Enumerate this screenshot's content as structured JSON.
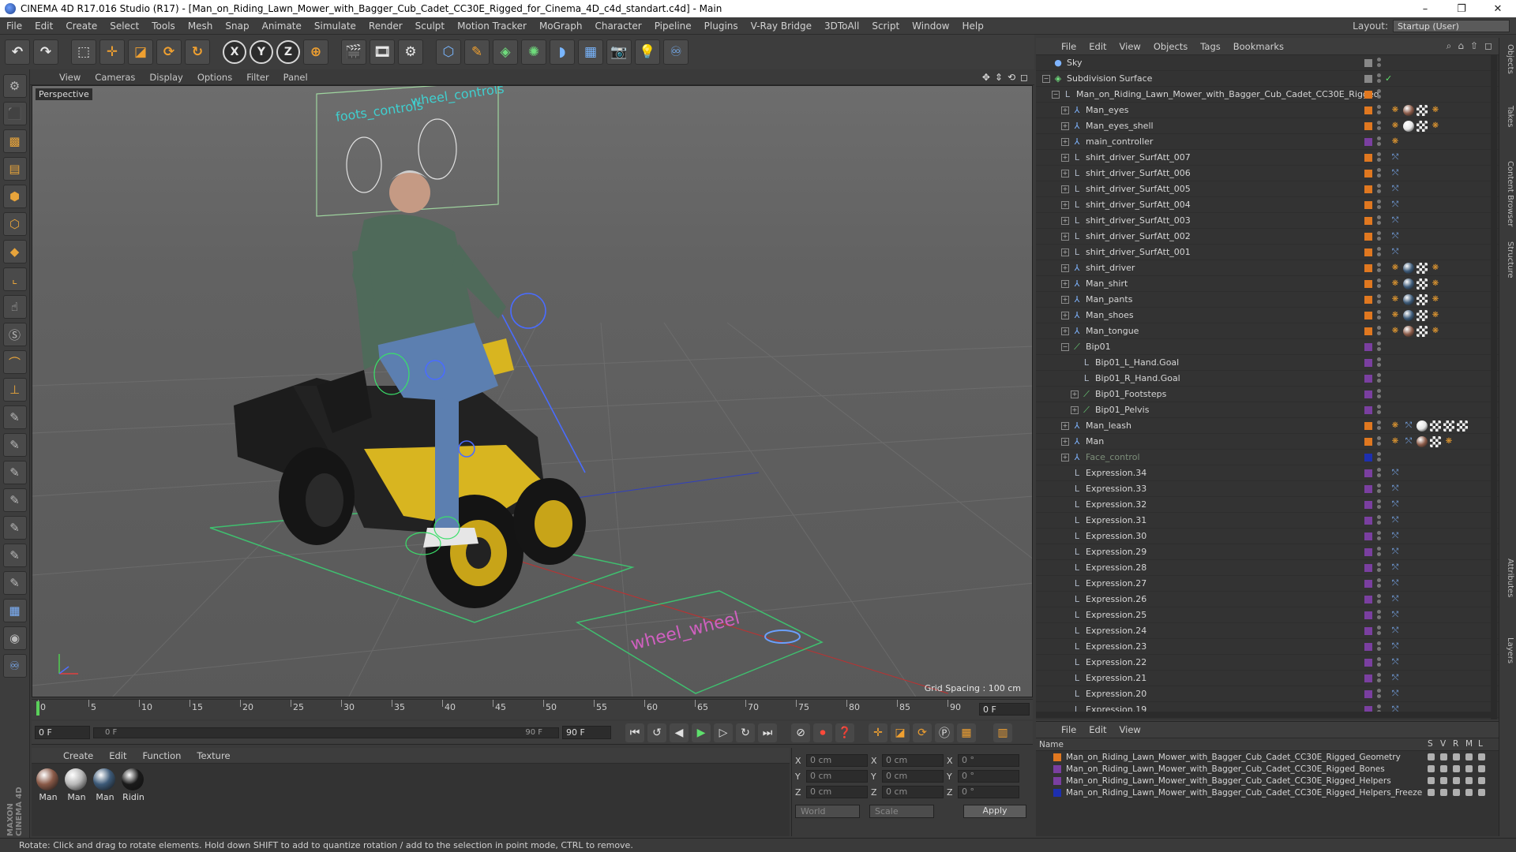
{
  "window": {
    "title": "CINEMA 4D R17.016 Studio (R17) - [Man_on_Riding_Lawn_Mower_with_Bagger_Cub_Cadet_CC30E_Rigged_for_Cinema_4D_c4d_standart.c4d] - Main",
    "controls": [
      "–",
      "❐",
      "✕"
    ]
  },
  "menubar": {
    "items": [
      "File",
      "Edit",
      "Create",
      "Select",
      "Tools",
      "Mesh",
      "Snap",
      "Animate",
      "Simulate",
      "Render",
      "Sculpt",
      "Motion Tracker",
      "MoGraph",
      "Character",
      "Pipeline",
      "Plugins",
      "V-Ray Bridge",
      "3DToAll",
      "Script",
      "Window",
      "Help"
    ],
    "layout_label": "Layout:",
    "layout_value": "Startup (User)"
  },
  "toolbar": {
    "x_label": "X",
    "y_label": "Y",
    "z_label": "Z"
  },
  "viewport": {
    "menu": [
      "View",
      "Cameras",
      "Display",
      "Options",
      "Filter",
      "Panel"
    ],
    "label": "Perspective",
    "grid_spacing": "Grid Spacing : 100 cm",
    "scene_text": [
      "foots_controls",
      "wheel_controls",
      "wheel_wheel"
    ]
  },
  "timeline": {
    "ticks": [
      "0",
      "5",
      "10",
      "15",
      "20",
      "25",
      "30",
      "35",
      "40",
      "45",
      "50",
      "55",
      "60",
      "65",
      "70",
      "75",
      "80",
      "85",
      "90"
    ],
    "current_frame": "0 F"
  },
  "playback": {
    "start_field": "0 F",
    "range_start": "0 F",
    "range_end": "90 F",
    "end_field": "90 F"
  },
  "material_manager": {
    "menu": [
      "Create",
      "Edit",
      "Function",
      "Texture"
    ],
    "materials": [
      {
        "label": "Man",
        "color": "#8a5a48"
      },
      {
        "label": "Man",
        "color": "#b8b8b8"
      },
      {
        "label": "Man",
        "color": "#3d5a78"
      },
      {
        "label": "Ridin",
        "color": "#1a1a1a"
      }
    ]
  },
  "coordinates": {
    "rows": [
      {
        "a": "X",
        "av": "0 cm",
        "b": "X",
        "bv": "0 cm",
        "c": "X",
        "cv": "0 °"
      },
      {
        "a": "Y",
        "av": "0 cm",
        "b": "Y",
        "bv": "0 cm",
        "c": "Y",
        "cv": "0 °"
      },
      {
        "a": "Z",
        "av": "0 cm",
        "b": "Z",
        "bv": "0 cm",
        "c": "Z",
        "cv": "0 °"
      }
    ],
    "mode": "World",
    "scale": "Scale",
    "apply": "Apply"
  },
  "status": "Rotate: Click and drag to rotate elements. Hold down SHIFT to add to quantize rotation / add to the selection in point mode, CTRL to remove.",
  "object_manager": {
    "menu": [
      "File",
      "Edit",
      "View",
      "Objects",
      "Tags",
      "Bookmarks"
    ],
    "objects": [
      {
        "name": "Sky",
        "indent": 0,
        "expand": "",
        "icon": "sky",
        "layer": ""
      },
      {
        "name": "Subdivision Surface",
        "indent": 0,
        "expand": "−",
        "icon": "subd",
        "layer": "",
        "check": "✓"
      },
      {
        "name": "Man_on_Riding_Lawn_Mower_with_Bagger_Cub_Cadet_CC30E_Rigged",
        "indent": 1,
        "expand": "−",
        "icon": "null",
        "layer": "#e07820"
      },
      {
        "name": "Man_eyes",
        "indent": 2,
        "expand": "+",
        "icon": "joint",
        "layer": "#e07820",
        "tags": [
          "orangeico",
          "ball:#8a5a48",
          "ph",
          "orangeico"
        ]
      },
      {
        "name": "Man_eyes_shell",
        "indent": 2,
        "expand": "+",
        "icon": "joint",
        "layer": "#e07820",
        "tags": [
          "orangeico",
          "ball:#e5e5e5",
          "ph",
          "orangeico"
        ]
      },
      {
        "name": "main_controller",
        "indent": 2,
        "expand": "+",
        "icon": "joint",
        "layer": "#7a3fa0",
        "tags": [
          "orangeico"
        ]
      },
      {
        "name": "shirt_driver_SurfAtt_007",
        "indent": 2,
        "expand": "+",
        "icon": "null",
        "layer": "#e07820",
        "tags": [
          "blueico"
        ]
      },
      {
        "name": "shirt_driver_SurfAtt_006",
        "indent": 2,
        "expand": "+",
        "icon": "null",
        "layer": "#e07820",
        "tags": [
          "blueico"
        ]
      },
      {
        "name": "shirt_driver_SurfAtt_005",
        "indent": 2,
        "expand": "+",
        "icon": "null",
        "layer": "#e07820",
        "tags": [
          "blueico"
        ]
      },
      {
        "name": "shirt_driver_SurfAtt_004",
        "indent": 2,
        "expand": "+",
        "icon": "null",
        "layer": "#e07820",
        "tags": [
          "blueico"
        ]
      },
      {
        "name": "shirt_driver_SurfAtt_003",
        "indent": 2,
        "expand": "+",
        "icon": "null",
        "layer": "#e07820",
        "tags": [
          "blueico"
        ]
      },
      {
        "name": "shirt_driver_SurfAtt_002",
        "indent": 2,
        "expand": "+",
        "icon": "null",
        "layer": "#e07820",
        "tags": [
          "blueico"
        ]
      },
      {
        "name": "shirt_driver_SurfAtt_001",
        "indent": 2,
        "expand": "+",
        "icon": "null",
        "layer": "#e07820",
        "tags": [
          "blueico"
        ]
      },
      {
        "name": "shirt_driver",
        "indent": 2,
        "expand": "+",
        "icon": "joint",
        "layer": "#e07820",
        "tags": [
          "orangeico",
          "ball:#3d5a78",
          "ph",
          "orangeico"
        ]
      },
      {
        "name": "Man_shirt",
        "indent": 2,
        "expand": "+",
        "icon": "joint",
        "layer": "#e07820",
        "tags": [
          "orangeico",
          "ball:#3d5a78",
          "ph",
          "orangeico"
        ]
      },
      {
        "name": "Man_pants",
        "indent": 2,
        "expand": "+",
        "icon": "joint",
        "layer": "#e07820",
        "tags": [
          "orangeico",
          "ball:#3d5a78",
          "ph",
          "orangeico"
        ]
      },
      {
        "name": "Man_shoes",
        "indent": 2,
        "expand": "+",
        "icon": "joint",
        "layer": "#e07820",
        "tags": [
          "orangeico",
          "ball:#3d5a78",
          "ph",
          "orangeico"
        ]
      },
      {
        "name": "Man_tongue",
        "indent": 2,
        "expand": "+",
        "icon": "joint",
        "layer": "#e07820",
        "tags": [
          "orangeico",
          "ball:#8a5a48",
          "ph",
          "orangeico"
        ]
      },
      {
        "name": "Bip01",
        "indent": 2,
        "expand": "−",
        "icon": "bone",
        "layer": "#7a3fa0"
      },
      {
        "name": "Bip01_L_Hand.Goal",
        "indent": 3,
        "expand": "",
        "icon": "null",
        "layer": "#7a3fa0"
      },
      {
        "name": "Bip01_R_Hand.Goal",
        "indent": 3,
        "expand": "",
        "icon": "null",
        "layer": "#7a3fa0"
      },
      {
        "name": "Bip01_Footsteps",
        "indent": 3,
        "expand": "+",
        "icon": "bone",
        "layer": "#7a3fa0"
      },
      {
        "name": "Bip01_Pelvis",
        "indent": 3,
        "expand": "+",
        "icon": "bone",
        "layer": "#7a3fa0"
      },
      {
        "name": "Man_leash",
        "indent": 2,
        "expand": "+",
        "icon": "joint",
        "layer": "#e07820",
        "tags": [
          "orangeico",
          "blueico",
          "ball:#e5e5e5",
          "ph",
          "ph",
          "ph"
        ]
      },
      {
        "name": "Man",
        "indent": 2,
        "expand": "+",
        "icon": "joint",
        "layer": "#e07820",
        "tags": [
          "orangeico",
          "blueico",
          "ball:#8a5a48",
          "ph",
          "orangeico"
        ]
      },
      {
        "name": "Face_control",
        "indent": 2,
        "expand": "+",
        "icon": "joint",
        "layer": "#1d2fb0",
        "dim": true
      },
      {
        "name": "Expression.34",
        "indent": 2,
        "expand": "",
        "icon": "null",
        "layer": "#7a3fa0",
        "tags": [
          "blueico"
        ]
      },
      {
        "name": "Expression.33",
        "indent": 2,
        "expand": "",
        "icon": "null",
        "layer": "#7a3fa0",
        "tags": [
          "blueico"
        ]
      },
      {
        "name": "Expression.32",
        "indent": 2,
        "expand": "",
        "icon": "null",
        "layer": "#7a3fa0",
        "tags": [
          "blueico"
        ]
      },
      {
        "name": "Expression.31",
        "indent": 2,
        "expand": "",
        "icon": "null",
        "layer": "#7a3fa0",
        "tags": [
          "blueico"
        ]
      },
      {
        "name": "Expression.30",
        "indent": 2,
        "expand": "",
        "icon": "null",
        "layer": "#7a3fa0",
        "tags": [
          "blueico"
        ]
      },
      {
        "name": "Expression.29",
        "indent": 2,
        "expand": "",
        "icon": "null",
        "layer": "#7a3fa0",
        "tags": [
          "blueico"
        ]
      },
      {
        "name": "Expression.28",
        "indent": 2,
        "expand": "",
        "icon": "null",
        "layer": "#7a3fa0",
        "tags": [
          "blueico"
        ]
      },
      {
        "name": "Expression.27",
        "indent": 2,
        "expand": "",
        "icon": "null",
        "layer": "#7a3fa0",
        "tags": [
          "blueico"
        ]
      },
      {
        "name": "Expression.26",
        "indent": 2,
        "expand": "",
        "icon": "null",
        "layer": "#7a3fa0",
        "tags": [
          "blueico"
        ]
      },
      {
        "name": "Expression.25",
        "indent": 2,
        "expand": "",
        "icon": "null",
        "layer": "#7a3fa0",
        "tags": [
          "blueico"
        ]
      },
      {
        "name": "Expression.24",
        "indent": 2,
        "expand": "",
        "icon": "null",
        "layer": "#7a3fa0",
        "tags": [
          "blueico"
        ]
      },
      {
        "name": "Expression.23",
        "indent": 2,
        "expand": "",
        "icon": "null",
        "layer": "#7a3fa0",
        "tags": [
          "blueico"
        ]
      },
      {
        "name": "Expression.22",
        "indent": 2,
        "expand": "",
        "icon": "null",
        "layer": "#7a3fa0",
        "tags": [
          "blueico"
        ]
      },
      {
        "name": "Expression.21",
        "indent": 2,
        "expand": "",
        "icon": "null",
        "layer": "#7a3fa0",
        "tags": [
          "blueico"
        ]
      },
      {
        "name": "Expression.20",
        "indent": 2,
        "expand": "",
        "icon": "null",
        "layer": "#7a3fa0",
        "tags": [
          "blueico"
        ]
      },
      {
        "name": "Expression.19",
        "indent": 2,
        "expand": "",
        "icon": "null",
        "layer": "#7a3fa0",
        "tags": [
          "blueico"
        ]
      }
    ]
  },
  "layer_manager": {
    "menu": [
      "File",
      "Edit",
      "View"
    ],
    "header": {
      "name": "Name",
      "cols": [
        "S",
        "V",
        "R",
        "M",
        "L"
      ]
    },
    "layers": [
      {
        "name": "Man_on_Riding_Lawn_Mower_with_Bagger_Cub_Cadet_CC30E_Rigged_Geometry",
        "color": "#e07820"
      },
      {
        "name": "Man_on_Riding_Lawn_Mower_with_Bagger_Cub_Cadet_CC30E_Rigged_Bones",
        "color": "#7a3fa0"
      },
      {
        "name": "Man_on_Riding_Lawn_Mower_with_Bagger_Cub_Cadet_CC30E_Rigged_Helpers",
        "color": "#7a3fa0"
      },
      {
        "name": "Man_on_Riding_Lawn_Mower_with_Bagger_Cub_Cadet_CC30E_Rigged_Helpers_Freeze",
        "color": "#1d2fb0"
      }
    ]
  },
  "right_tabs": [
    "Objects",
    "Takes",
    "Content Browser",
    "Structure",
    "Attributes",
    "Layers"
  ],
  "brand": "MAXON CINEMA 4D"
}
